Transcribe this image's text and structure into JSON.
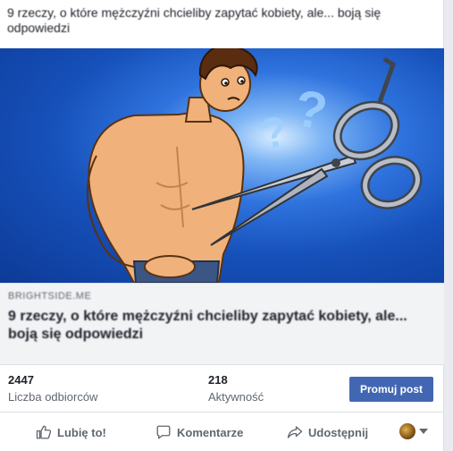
{
  "post": {
    "text": "9 rzeczy, o które mężczyźni chcieliby zapytać kobiety, ale... boją się odpowiedzi"
  },
  "link": {
    "domain": "BRIGHTSIDE.ME",
    "title": "9 rzeczy, o które mężczyźni chcieliby zapytać kobiety, ale... boją się odpowiedzi"
  },
  "stats": {
    "reach_value": "2447",
    "reach_label": "Liczba odbiorców",
    "engagement_value": "218",
    "engagement_label": "Aktywność",
    "promote_label": "Promuj post"
  },
  "actions": {
    "like_label": "Lubię to!",
    "comment_label": "Komentarze",
    "share_label": "Udostępnij"
  },
  "colors": {
    "accent": "#4267b2",
    "media_background": "#1650b9"
  }
}
